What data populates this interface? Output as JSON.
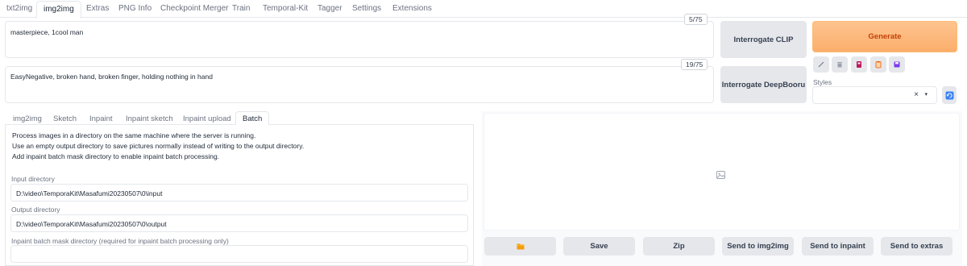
{
  "top_tabs": [
    "txt2img",
    "img2img",
    "Extras",
    "PNG Info",
    "Checkpoint Merger",
    "Train",
    "Temporal-Kit",
    "Tagger",
    "Settings",
    "Extensions"
  ],
  "prompt": {
    "value": "masterpiece, 1cool man",
    "token_count": "5/75"
  },
  "negative_prompt": {
    "value": "EasyNegative, broken hand, broken finger, holding nothing in hand",
    "token_count": "19/75"
  },
  "interrogate": {
    "clip": "Interrogate CLIP",
    "deepbooru": "Interrogate DeepBooru"
  },
  "generate_label": "Generate",
  "tool_icons": [
    "pencil-icon",
    "trash-icon",
    "bookmark-icon",
    "clipboard-icon",
    "save-icon"
  ],
  "styles": {
    "label": "Styles",
    "clear": "×",
    "caret": "▾"
  },
  "sub_tabs": [
    "img2img",
    "Sketch",
    "Inpaint",
    "Inpaint sketch",
    "Inpaint upload",
    "Batch"
  ],
  "batch": {
    "info": [
      "Process images in a directory on the same machine where the server is running.",
      "Use an empty output directory to save pictures normally instead of writing to the output directory.",
      "Add inpaint batch mask directory to enable inpaint batch processing."
    ],
    "input_dir": {
      "label": "Input directory",
      "value": "D:\\video\\TemporaKit\\Masafumi20230507\\0\\input"
    },
    "output_dir": {
      "label": "Output directory",
      "value": "D:\\video\\TemporaKit\\Masafumi20230507\\0\\output"
    },
    "mask_dir": {
      "label": "Inpaint batch mask directory (required for inpaint batch processing only)",
      "value": ""
    }
  },
  "output_buttons": {
    "folder": "folder-icon",
    "save": "Save",
    "zip": "Zip",
    "send_img2img": "Send to img2img",
    "send_inpaint": "Send to inpaint",
    "send_extras": "Send to extras"
  },
  "colors": {
    "generate_bg": "#fdba74",
    "generate_text": "#c2410c",
    "button_bg": "#e5e7eb",
    "refresh_icon": "#3b82f6"
  }
}
